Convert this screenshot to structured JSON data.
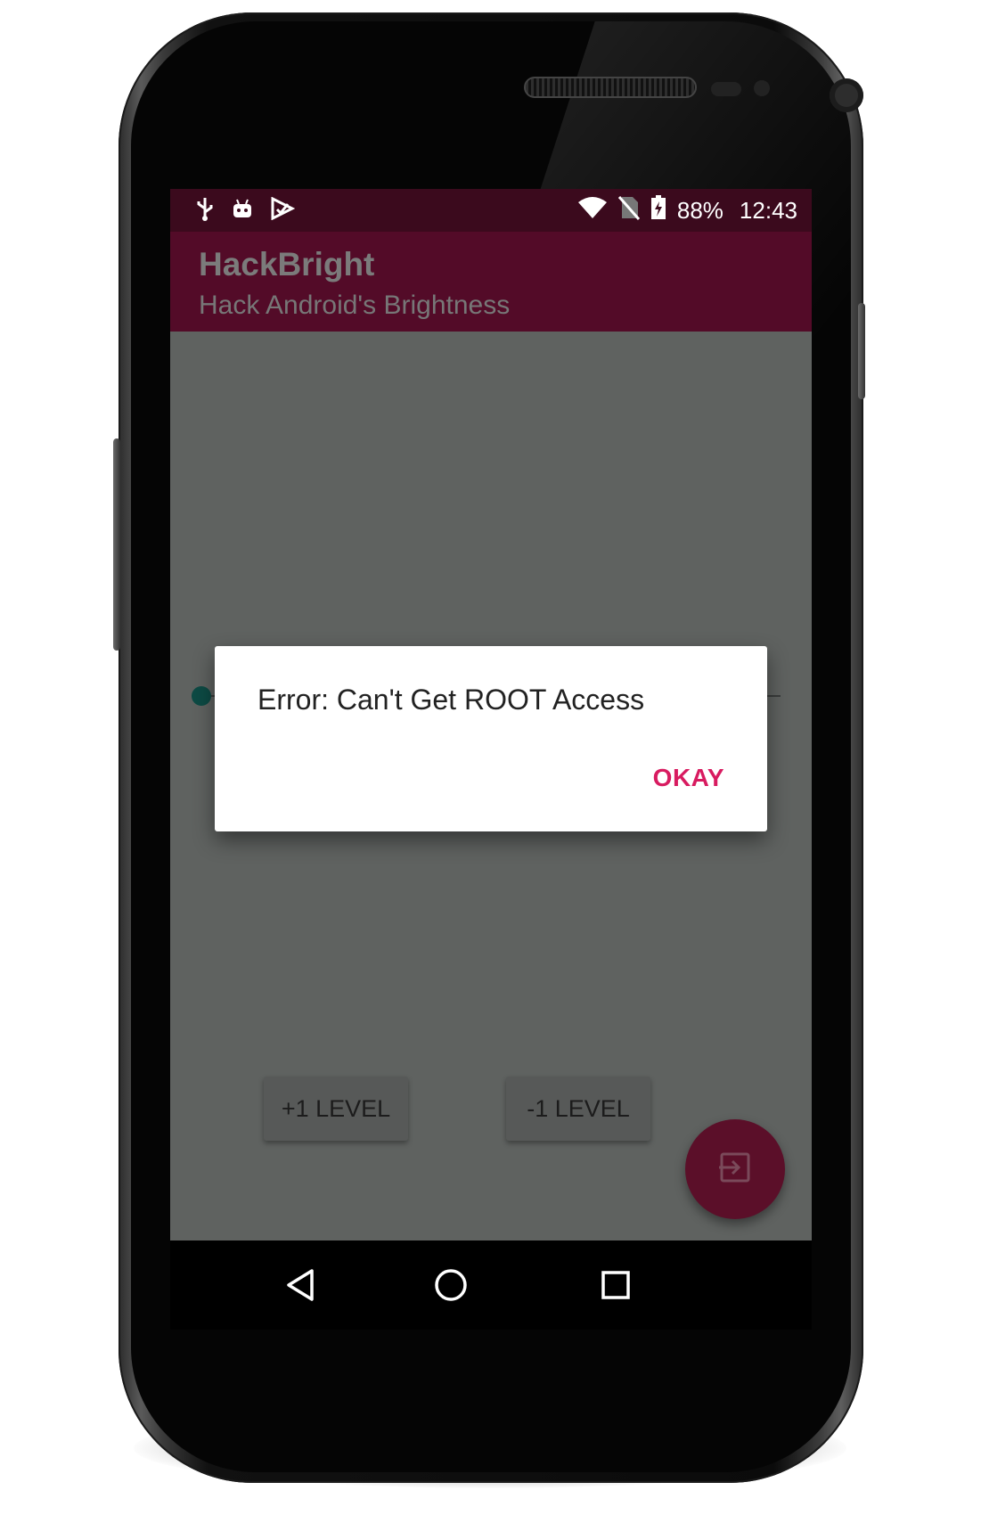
{
  "status_bar": {
    "battery": "88%",
    "time": "12:43",
    "icons_left": [
      "usb-icon",
      "android-debug-icon",
      "play-store-icon"
    ],
    "icons_right": [
      "wifi-icon",
      "no-sim-icon",
      "battery-charging-icon"
    ]
  },
  "app_bar": {
    "title": "HackBright",
    "subtitle": "Hack Android's Brightness"
  },
  "brightness_slider": {
    "value": 0
  },
  "buttons": {
    "plus_level": "+1 LEVEL",
    "minus_level": "-1 LEVEL"
  },
  "fab": {
    "icon": "exit-to-app-icon"
  },
  "dialog": {
    "message": "Error: Can't Get ROOT Access",
    "ok_label": "OKAY"
  },
  "nav_bar": {
    "items": [
      "back-icon",
      "home-icon",
      "recents-icon"
    ]
  },
  "colors": {
    "status_bar": "#3b0a1d",
    "app_bar": "#530b28",
    "accent": "#d81b60",
    "fab": "#5b0f29",
    "scrim_background": "#5f6260"
  }
}
